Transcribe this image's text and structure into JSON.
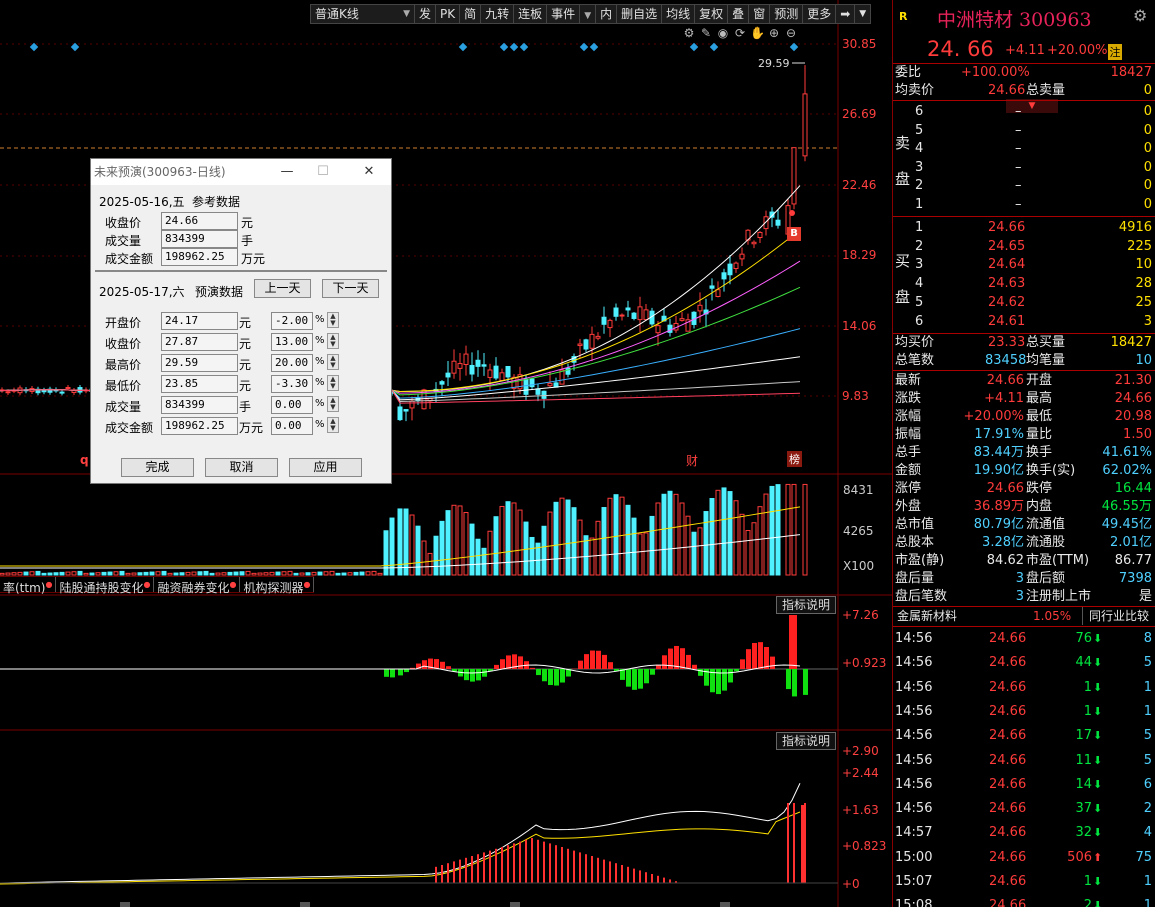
{
  "toolbar": {
    "period_select": "普通K线",
    "buttons": [
      "发",
      "PK",
      "简",
      "九转",
      "连板",
      "事件",
      "内",
      "删自选",
      "均线",
      "复权",
      "叠",
      "窗",
      "预测",
      "更多"
    ]
  },
  "chart": {
    "price_axis": [
      "30.85",
      "26.69",
      "22.46",
      "18.29",
      "14.06",
      "9.83"
    ],
    "high_label": "29.59",
    "buy_marker": "B",
    "q_marker": "q",
    "event_labels": [
      "财",
      "榜"
    ],
    "volume_axis": [
      "8431",
      "4265",
      "X100"
    ],
    "macd_axis": [
      "+7.26",
      "+0.923"
    ],
    "ind2_axis": [
      "+2.90",
      "+2.44",
      "+1.63",
      "+0.823",
      "+0"
    ],
    "indicator_btn": "指标说明",
    "tabs": [
      "率(ttm)",
      "陆股通持股变化",
      "融资融券变化",
      "机构探测器"
    ]
  },
  "dialog": {
    "title": "未来预演(300963-日线)",
    "ref_date": "2025-05-16,五",
    "ref_title": "参考数据",
    "ref_rows": [
      {
        "label": "收盘价",
        "value": "24.66",
        "unit": "元"
      },
      {
        "label": "成交量",
        "value": "834399",
        "unit": "手"
      },
      {
        "label": "成交金额",
        "value": "198962.25",
        "unit": "万元"
      }
    ],
    "pred_date": "2025-05-17,六",
    "pred_title": "预演数据",
    "prev_day": "上一天",
    "next_day": "下一天",
    "pred_rows": [
      {
        "label": "开盘价",
        "value": "24.17",
        "unit": "元",
        "pct": "-2.00"
      },
      {
        "label": "收盘价",
        "value": "27.87",
        "unit": "元",
        "pct": "13.00"
      },
      {
        "label": "最高价",
        "value": "29.59",
        "unit": "元",
        "pct": "20.00"
      },
      {
        "label": "最低价",
        "value": "23.85",
        "unit": "元",
        "pct": "-3.30"
      },
      {
        "label": "成交量",
        "value": "834399",
        "unit": "手",
        "pct": "0.00"
      },
      {
        "label": "成交金额",
        "value": "198962.25",
        "unit": "万元",
        "pct": "0.00"
      }
    ],
    "pct_sign": "%",
    "btn_done": "完成",
    "btn_cancel": "取消",
    "btn_apply": "应用"
  },
  "quote": {
    "r_mark": "R",
    "name": "中洲特材 300963",
    "price": "24. 66",
    "change": "+4.11",
    "change_pct": "+20.00%",
    "zhu": "注",
    "weibi_label": "委比",
    "weibi_pct": "+100.00%",
    "weibi_val": "18427",
    "avg_sell_label": "均卖价",
    "avg_sell": "24.66",
    "total_sell_label": "总卖量",
    "total_sell": "0",
    "sell_label_1": "卖",
    "sell_label_2": "盘",
    "asks": [
      {
        "lvl": "6",
        "price": "–",
        "vol": "0"
      },
      {
        "lvl": "5",
        "price": "–",
        "vol": "0"
      },
      {
        "lvl": "4",
        "price": "–",
        "vol": "0"
      },
      {
        "lvl": "3",
        "price": "–",
        "vol": "0"
      },
      {
        "lvl": "2",
        "price": "–",
        "vol": "0"
      },
      {
        "lvl": "1",
        "price": "–",
        "vol": "0"
      }
    ],
    "buy_label_1": "买",
    "buy_label_2": "盘",
    "bids": [
      {
        "lvl": "1",
        "price": "24.66",
        "vol": "4916"
      },
      {
        "lvl": "2",
        "price": "24.65",
        "vol": "225"
      },
      {
        "lvl": "3",
        "price": "24.64",
        "vol": "10"
      },
      {
        "lvl": "4",
        "price": "24.63",
        "vol": "28"
      },
      {
        "lvl": "5",
        "price": "24.62",
        "vol": "25"
      },
      {
        "lvl": "6",
        "price": "24.61",
        "vol": "3"
      }
    ],
    "avg_buy_label": "均买价",
    "avg_buy": "23.33",
    "total_buy_label": "总买量",
    "total_buy": "18427",
    "total_deals_label": "总笔数",
    "total_deals": "83458",
    "avg_deal_label": "均笔量",
    "avg_deal": "10",
    "stats": [
      {
        "l1": "最新",
        "v1": "24.66",
        "c1": "red",
        "l2": "开盘",
        "v2": "21.30",
        "c2": "red"
      },
      {
        "l1": "涨跌",
        "v1": "+4.11",
        "c1": "red",
        "l2": "最高",
        "v2": "24.66",
        "c2": "red"
      },
      {
        "l1": "涨幅",
        "v1": "+20.00%",
        "c1": "red",
        "l2": "最低",
        "v2": "20.98",
        "c2": "red"
      },
      {
        "l1": "振幅",
        "v1": "17.91%",
        "c1": "cyan",
        "l2": "量比",
        "v2": "1.50",
        "c2": "red"
      },
      {
        "l1": "总手",
        "v1": "83.44万",
        "c1": "cyan",
        "l2": "换手",
        "v2": "41.61%",
        "c2": "cyan"
      },
      {
        "l1": "金额",
        "v1": "19.90亿",
        "c1": "cyan",
        "l2": "换手(实)",
        "v2": "62.02%",
        "c2": "cyan"
      },
      {
        "l1": "涨停",
        "v1": "24.66",
        "c1": "red",
        "l2": "跌停",
        "v2": "16.44",
        "c2": "green"
      },
      {
        "l1": "外盘",
        "v1": "36.89万",
        "c1": "red",
        "l2": "内盘",
        "v2": "46.55万",
        "c2": "green"
      },
      {
        "l1": "总市值",
        "v1": "80.79亿",
        "c1": "cyan",
        "l2": "流通值",
        "v2": "49.45亿",
        "c2": "cyan"
      },
      {
        "l1": "总股本",
        "v1": "3.28亿",
        "c1": "cyan",
        "l2": "流通股",
        "v2": "2.01亿",
        "c2": "cyan"
      },
      {
        "l1": "市盈(静)",
        "v1": "84.62",
        "c1": "white",
        "l2": "市盈(TTM)",
        "v2": "86.77",
        "c2": "white"
      },
      {
        "l1": "盘后量",
        "v1": "3",
        "c1": "cyan",
        "l2": "盘后额",
        "v2": "7398",
        "c2": "cyan"
      },
      {
        "l1": "盘后笔数",
        "v1": "3",
        "c1": "cyan",
        "l2": "注册制上市",
        "v2": "是",
        "c2": "white"
      }
    ],
    "industry": "金属新材料",
    "industry_pct": "1.05%",
    "compare_btn": "同行业比较",
    "ticks": [
      {
        "time": "14:56",
        "price": "24.66",
        "vol": "76",
        "dir": "down",
        "n": "8"
      },
      {
        "time": "14:56",
        "price": "24.66",
        "vol": "44",
        "dir": "down",
        "n": "5"
      },
      {
        "time": "14:56",
        "price": "24.66",
        "vol": "1",
        "dir": "down",
        "n": "1"
      },
      {
        "time": "14:56",
        "price": "24.66",
        "vol": "1",
        "dir": "down",
        "n": "1"
      },
      {
        "time": "14:56",
        "price": "24.66",
        "vol": "17",
        "dir": "down",
        "n": "5"
      },
      {
        "time": "14:56",
        "price": "24.66",
        "vol": "11",
        "dir": "down",
        "n": "5"
      },
      {
        "time": "14:56",
        "price": "24.66",
        "vol": "14",
        "dir": "down",
        "n": "6"
      },
      {
        "time": "14:56",
        "price": "24.66",
        "vol": "37",
        "dir": "down",
        "n": "2"
      },
      {
        "time": "14:57",
        "price": "24.66",
        "vol": "32",
        "dir": "down",
        "n": "4"
      },
      {
        "time": "15:00",
        "price": "24.66",
        "vol": "506",
        "dir": "up",
        "n": "75"
      },
      {
        "time": "15:07",
        "price": "24.66",
        "vol": "1",
        "dir": "down",
        "n": "1"
      },
      {
        "time": "15:08",
        "price": "24.66",
        "vol": "2",
        "dir": "down",
        "n": "1"
      }
    ]
  }
}
